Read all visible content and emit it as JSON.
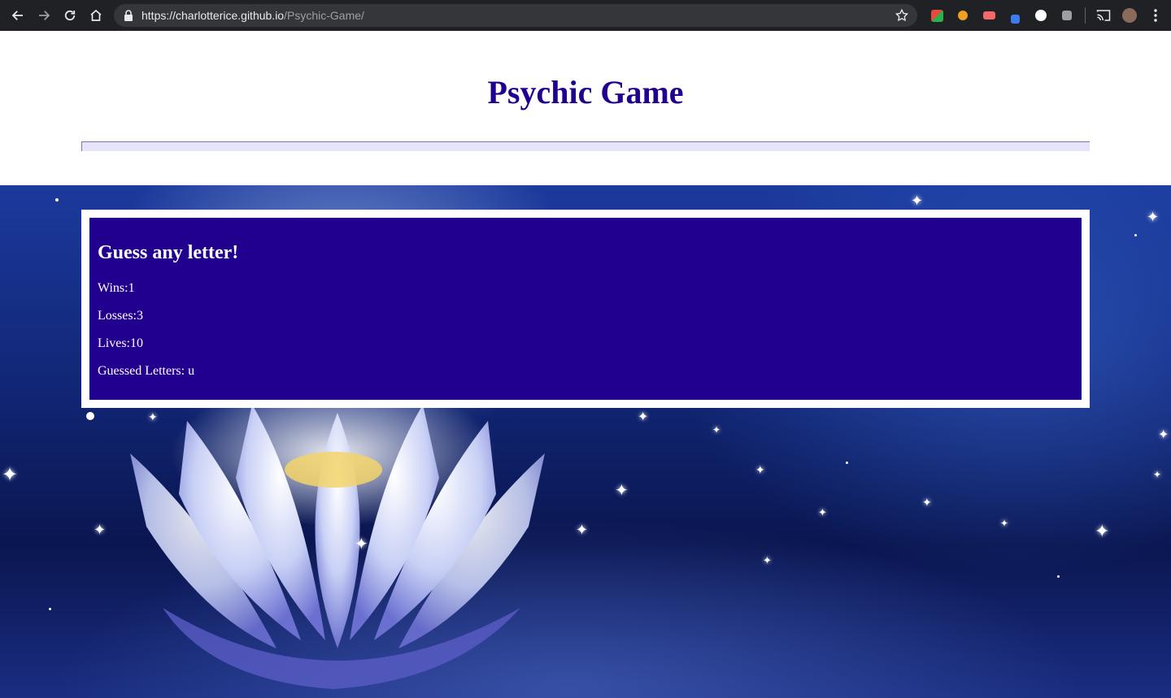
{
  "browser": {
    "url_host": "https://charlotterice.github.io",
    "url_path": "/Psychic-Game/",
    "nav_icons": [
      "back-arrow-icon",
      "forward-arrow-icon",
      "reload-icon",
      "home-icon"
    ],
    "extensions": [
      {
        "name": "extension-icon-1",
        "color": "#e84a3c"
      },
      {
        "name": "extension-icon-2",
        "color": "#f0a020"
      },
      {
        "name": "extension-icon-3",
        "color": "#f06a6a"
      },
      {
        "name": "extension-icon-4",
        "color": "#3d7bf0"
      },
      {
        "name": "extension-icon-5",
        "color": "#ffffff"
      },
      {
        "name": "extension-icon-6",
        "color": "#9aa0a6"
      }
    ]
  },
  "page": {
    "title": "Psychic Game"
  },
  "game": {
    "heading": "Guess any letter!",
    "wins": "Wins:1",
    "losses": "Losses:3",
    "lives": "Lives:10",
    "guessed": "Guessed Letters: u"
  }
}
